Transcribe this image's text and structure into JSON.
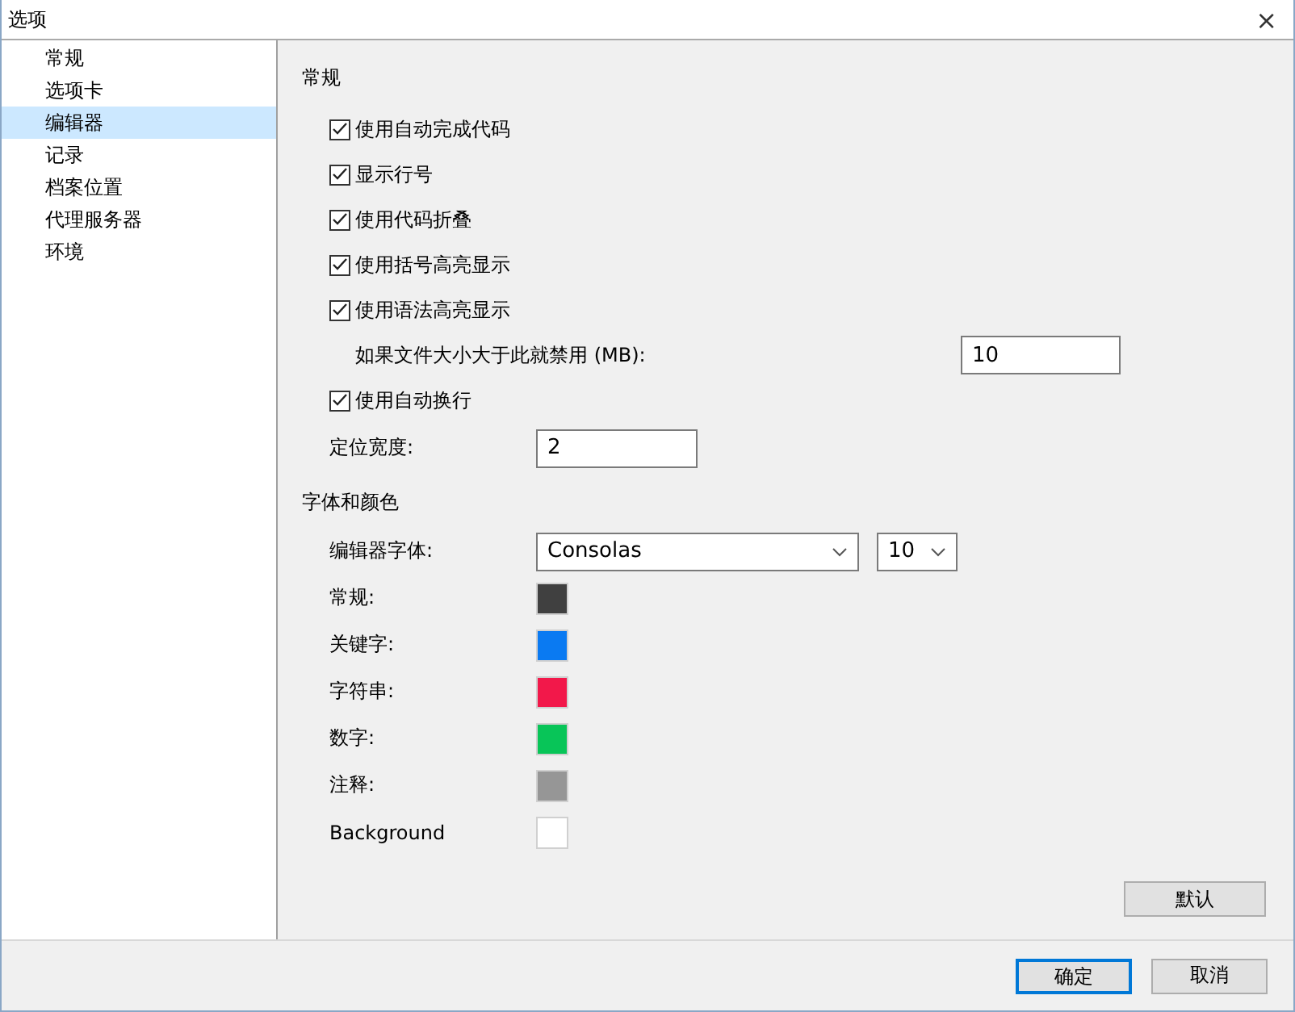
{
  "window": {
    "title": "选项",
    "close": "×"
  },
  "sidebar": {
    "items": [
      {
        "label": "常规",
        "selected": false
      },
      {
        "label": "选项卡",
        "selected": false
      },
      {
        "label": "编辑器",
        "selected": true
      },
      {
        "label": "记录",
        "selected": false
      },
      {
        "label": "档案位置",
        "selected": false
      },
      {
        "label": "代理服务器",
        "selected": false
      },
      {
        "label": "环境",
        "selected": false
      }
    ]
  },
  "general": {
    "heading": "常规",
    "rows": [
      {
        "kind": "checkbox",
        "label": "使用自动完成代码",
        "checked": true
      },
      {
        "kind": "checkbox",
        "label": "显示行号",
        "checked": true
      },
      {
        "kind": "checkbox",
        "label": "使用代码折叠",
        "checked": true
      },
      {
        "kind": "checkbox",
        "label": "使用括号高亮显示",
        "checked": true
      },
      {
        "kind": "checkbox",
        "label": "使用语法高亮显示",
        "checked": true
      },
      {
        "kind": "input",
        "label": "如果文件大小大于此就禁用 (MB):",
        "value": "10",
        "indent": true
      },
      {
        "kind": "checkbox",
        "label": "使用自动换行",
        "checked": true
      },
      {
        "kind": "input",
        "label": "定位宽度:",
        "value": "2",
        "indent": false
      }
    ]
  },
  "fonts": {
    "heading": "字体和颜色",
    "font_label": "编辑器字体:",
    "font": "Consolas",
    "size": "10",
    "colors": [
      {
        "label": "常规:",
        "color": "#404040"
      },
      {
        "label": "关键字:",
        "color": "#0a7af2"
      },
      {
        "label": "字符串:",
        "color": "#f2184a"
      },
      {
        "label": "数字:",
        "color": "#08c558"
      },
      {
        "label": "注释:",
        "color": "#969696"
      },
      {
        "label": "Background",
        "color": "#ffffff"
      }
    ]
  },
  "buttons": {
    "default": "默认",
    "ok": "确定",
    "cancel": "取消"
  }
}
